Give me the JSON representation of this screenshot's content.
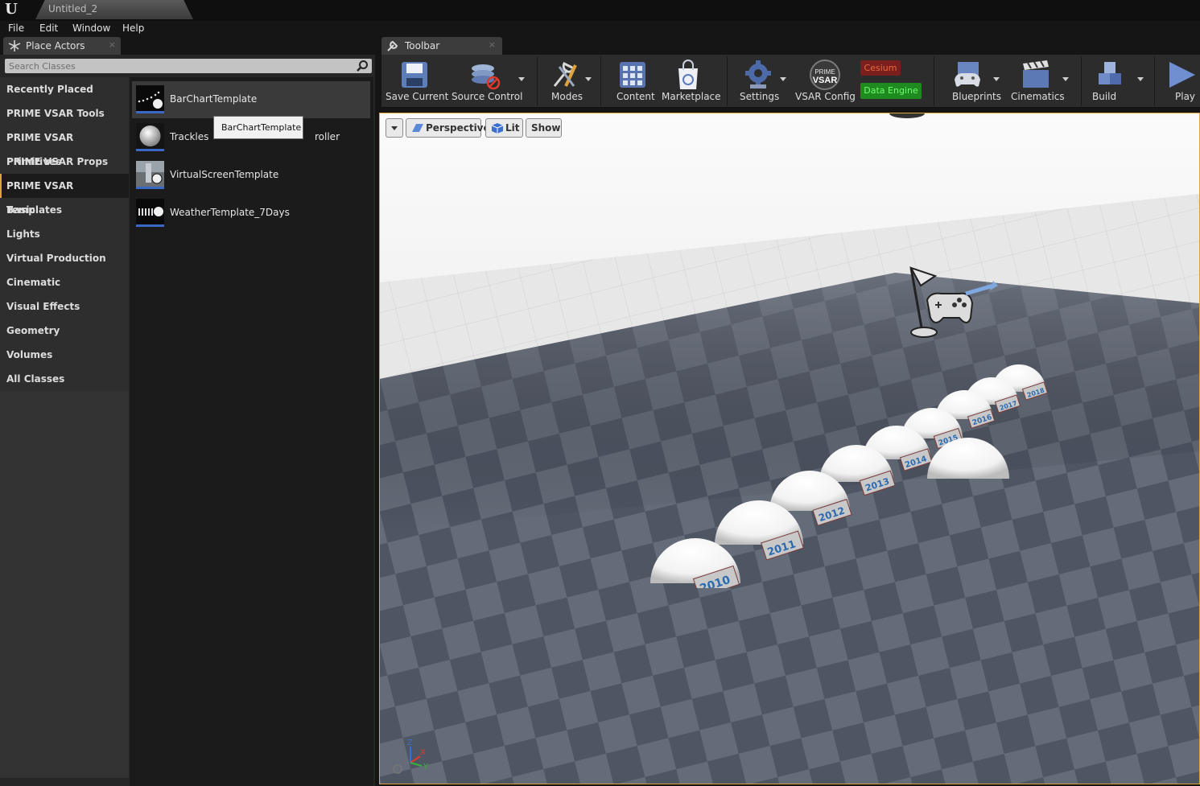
{
  "window": {
    "tab_title": "Untitled_2",
    "logo": "U"
  },
  "menu": {
    "items": [
      "File",
      "Edit",
      "Window",
      "Help"
    ]
  },
  "place_actors": {
    "tab_label": "Place Actors",
    "tab_icon": "place-actors-icon",
    "close": "×",
    "search_placeholder": "Search Classes",
    "categories": [
      "Recently Placed",
      "PRIME VSAR Tools",
      "PRIME VSAR Primitives",
      "PRIME VSAR Props",
      "PRIME VSAR Templates",
      "Basic",
      "Lights",
      "Virtual Production",
      "Cinematic",
      "Visual Effects",
      "Geometry",
      "Volumes",
      "All Classes"
    ],
    "selected_category": "PRIME VSAR Templates",
    "items": [
      {
        "label": "BarChartTemplate",
        "thumb": "bar-chart-thumb"
      },
      {
        "label": "Trackles",
        "label_tail": "roller",
        "thumb": "sphere-thumb"
      },
      {
        "label": "VirtualScreenTemplate",
        "thumb": "screen-thumb"
      },
      {
        "label": "WeatherTemplate_7Days",
        "thumb": "weather-thumb"
      }
    ],
    "tooltip": "BarChartTemplate"
  },
  "toolbar": {
    "tab_label": "Toolbar",
    "close": "×",
    "buttons": {
      "save": "Save Current",
      "source_control": "Source Control",
      "modes": "Modes",
      "content": "Content",
      "marketplace": "Marketplace",
      "settings": "Settings",
      "vsar_config": "VSAR Config",
      "blueprints": "Blueprints",
      "cinematics": "Cinematics",
      "build": "Build",
      "play": "Play"
    },
    "vsar_logo_top": "PRIME",
    "vsar_logo_bottom": "VSAR",
    "cesium": "Cesium",
    "data_engine": "Data Engine",
    "colors": {
      "cesium_bg": "#7a1e1e",
      "data_engine_bg": "#1f8a1f",
      "accent": "#e0a23a"
    }
  },
  "viewport": {
    "perspective": "Perspective",
    "lit": "Lit",
    "show": "Show",
    "year_labels": [
      "2010",
      "2011",
      "2012",
      "2013",
      "2014",
      "2015",
      "2016",
      "2017",
      "2018"
    ],
    "axis": {
      "z": "Z",
      "x": "X",
      "y": "Y"
    }
  }
}
